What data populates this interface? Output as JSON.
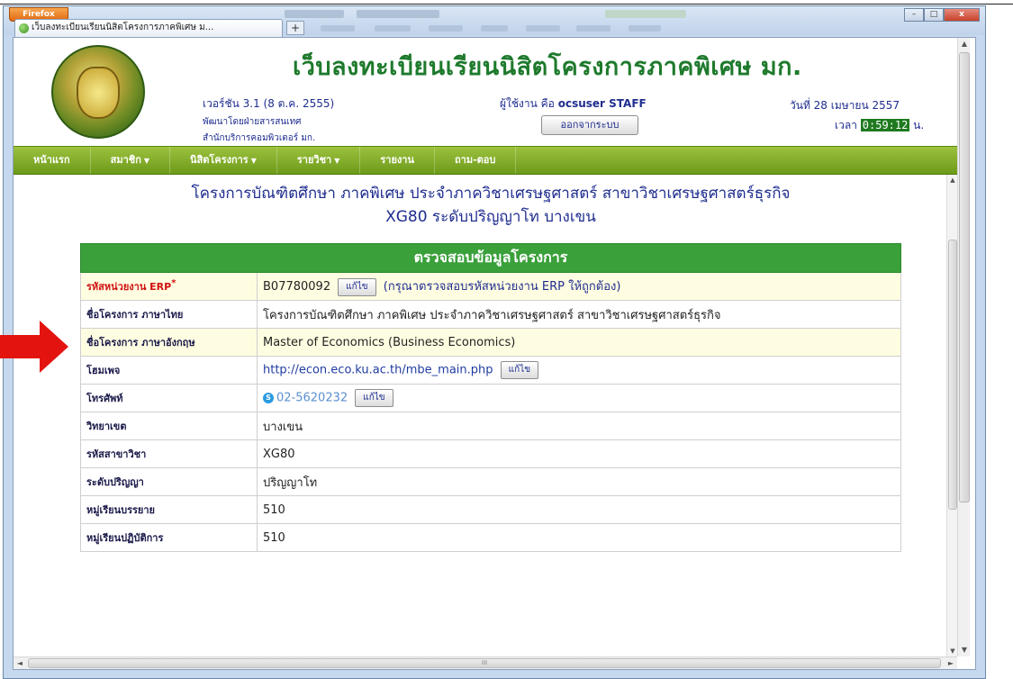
{
  "browser": {
    "app_button": "Firefox",
    "tab_title": "เว็บลงทะเบียนเรียนนิสิตโครงการภาคพิเศษ ม...",
    "new_tab": "+",
    "window_controls": {
      "minimize": "–",
      "maximize": "□",
      "close": "x"
    }
  },
  "header": {
    "site_title": "เว็บลงทะเบียนเรียนนิสิตโครงการภาคพิเศษ มก.",
    "version": "เวอร์ชัน 3.1 (8 ต.ค. 2555)",
    "developer_1": "พัฒนาโดยฝ่ายสารสนเทศ",
    "developer_2": "สำนักบริการคอมพิวเตอร์ มก.",
    "user_prefix": "ผู้ใช้งาน คือ",
    "user_name": "ocsuser STAFF",
    "logout_label": "ออกจากระบบ",
    "date": "วันที่ 28 เมษายน 2557",
    "time_prefix": "เวลา",
    "time": "0:59:12",
    "time_suffix": "น."
  },
  "menu": [
    {
      "label": "หน้าแรก",
      "caret": ""
    },
    {
      "label": "สมาชิก",
      "caret": "▼"
    },
    {
      "label": "นิสิตโครงการ",
      "caret": "▼"
    },
    {
      "label": "รายวิชา",
      "caret": "▼"
    },
    {
      "label": "รายงาน",
      "caret": ""
    },
    {
      "label": "ถาม-ตอบ",
      "caret": ""
    }
  ],
  "project": {
    "title_line1": "โครงการบัณฑิตศึกษา ภาคพิเศษ ประจำภาควิชาเศรษฐศาสตร์ สาขาวิชาเศรษฐศาสตร์ธุรกิจ",
    "title_line2": "XG80 ระดับปริญญาโท บางเขน"
  },
  "table": {
    "heading": "ตรวจสอบข้อมูลโครงการ",
    "edit_label": "แก้ไข",
    "required_star": "*",
    "rows": [
      {
        "label": "รหัสหน่วยงาน ERP",
        "value": "B07780092",
        "hint": "(กรุณาตรวจสอบรหัสหน่วยงาน ERP ให้ถูกต้อง)"
      },
      {
        "label": "ชื่อโครงการ ภาษาไทย",
        "value": "โครงการบัณฑิตศึกษา ภาคพิเศษ ประจำภาควิชาเศรษฐศาสตร์ สาขาวิชาเศรษฐศาสตร์ธุรกิจ"
      },
      {
        "label": "ชื่อโครงการ ภาษาอังกฤษ",
        "value": "Master of Economics (Business Economics)"
      },
      {
        "label": "โฮมเพจ",
        "value": "http://econ.eco.ku.ac.th/mbe_main.php"
      },
      {
        "label": "โทรศัพท์",
        "value": "02-5620232",
        "icon": "skype-icon",
        "icon_glyph": "S"
      },
      {
        "label": "วิทยาเขต",
        "value": "บางเขน"
      },
      {
        "label": "รหัสสาขาวิชา",
        "value": "XG80"
      },
      {
        "label": "ระดับปริญญา",
        "value": "ปริญญาโท"
      },
      {
        "label": "หมู่เรียนบรรยาย",
        "value": "510"
      },
      {
        "label": "หมู่เรียนปฏิบัติการ",
        "value": "510"
      }
    ]
  },
  "scroll": {
    "up": "▲",
    "down": "▼",
    "left": "◄",
    "right": "►",
    "hgrip": "III"
  },
  "colors": {
    "menu_green": "#7aa520",
    "table_head_green": "#3aa03a",
    "title_green": "#1e7a2c",
    "text_blue": "#1f2d8f",
    "required_red": "#d01010",
    "highlight_yellow": "#fffde1",
    "arrow_red": "#e3140f"
  }
}
